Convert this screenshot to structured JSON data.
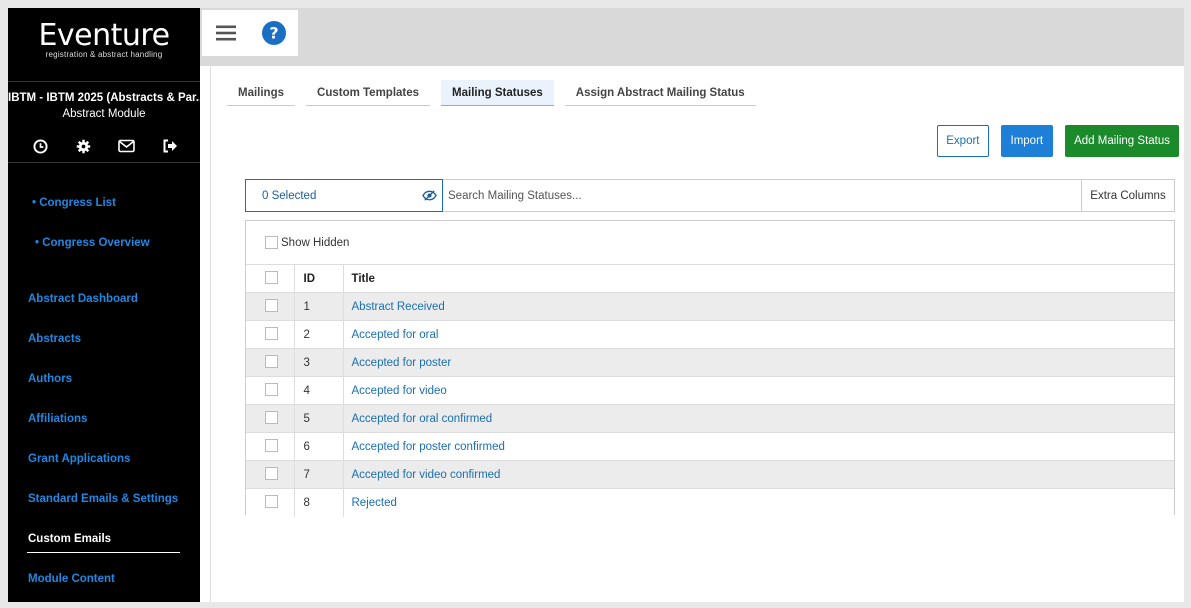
{
  "sidebar": {
    "logo_title": "Eventure",
    "logo_subtitle": "registration & abstract handling",
    "congress_name": "IBTM - IBTM 2025 (Abstracts & Par...",
    "module_name": "Abstract Module",
    "icons": [
      "clock-icon",
      "gear-icon",
      "envelope-icon",
      "sign-out-icon"
    ],
    "links": {
      "congress_list": "• Congress List",
      "congress_overview": "• Congress Overview",
      "abstract_dashboard": "Abstract Dashboard",
      "abstracts": "Abstracts",
      "authors": "Authors",
      "affiliations": "Affiliations",
      "grant_applications": "Grant Applications",
      "standard_emails": "Standard Emails & Settings",
      "custom_emails": "Custom Emails",
      "module_content": "Module Content"
    }
  },
  "topbar": {
    "menu_icon": "hamburger-menu-icon",
    "help_icon": "help-icon"
  },
  "tabs": [
    {
      "label": "Mailings",
      "active": false
    },
    {
      "label": "Custom Templates",
      "active": false
    },
    {
      "label": "Mailing Statuses",
      "active": true
    },
    {
      "label": "Assign Abstract Mailing Status",
      "active": false
    }
  ],
  "actions": {
    "export": "Export",
    "import": "Import",
    "add": "Add Mailing Status"
  },
  "search": {
    "selected": "0 Selected",
    "placeholder": "Search Mailing Statuses...",
    "extra_columns": "Extra Columns"
  },
  "table": {
    "show_hidden": "Show Hidden",
    "headers": {
      "id": "ID",
      "title": "Title"
    },
    "rows": [
      {
        "id": "1",
        "title": "Abstract Received"
      },
      {
        "id": "2",
        "title": "Accepted for oral"
      },
      {
        "id": "3",
        "title": "Accepted for poster"
      },
      {
        "id": "4",
        "title": "Accepted for video"
      },
      {
        "id": "5",
        "title": "Accepted for oral confirmed"
      },
      {
        "id": "6",
        "title": "Accepted for poster confirmed"
      },
      {
        "id": "7",
        "title": "Accepted for video confirmed"
      },
      {
        "id": "8",
        "title": "Rejected"
      }
    ]
  },
  "colors": {
    "link": "#1e88e5",
    "primary": "#1e7fd6",
    "success": "#1a8a2a",
    "sidebar_bg": "#000000"
  }
}
